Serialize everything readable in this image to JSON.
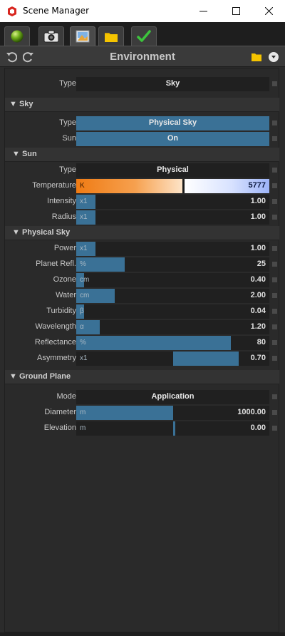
{
  "window": {
    "title": "Scene Manager",
    "minimize": "—",
    "maximize": "☐",
    "close": "✕"
  },
  "tabs": [
    {
      "name": "environment",
      "icon": "green-sphere-icon"
    },
    {
      "name": "camera",
      "icon": "camera-icon"
    },
    {
      "name": "image",
      "icon": "picture-icon"
    },
    {
      "name": "folder",
      "icon": "folder-icon"
    },
    {
      "name": "check",
      "icon": "checkmark-icon"
    }
  ],
  "toolbar": {
    "title": "Environment"
  },
  "environment": {
    "type_label": "Type",
    "type_value": "Sky"
  },
  "sky": {
    "section": "Sky",
    "type_label": "Type",
    "type_value": "Physical Sky",
    "sun_label": "Sun",
    "sun_value": "On"
  },
  "sun": {
    "section": "Sun",
    "type_label": "Type",
    "type_value": "Physical",
    "temperature": {
      "label": "Temperature",
      "unit": "K",
      "value": "5777",
      "fraction": 0.55
    },
    "intensity": {
      "label": "Intensity",
      "unit": "x1",
      "value": "1.00",
      "fraction": 0.1
    },
    "radius": {
      "label": "Radius",
      "unit": "x1",
      "value": "1.00",
      "fraction": 0.1
    }
  },
  "physical_sky": {
    "section": "Physical Sky",
    "rows": [
      {
        "key": "power",
        "label": "Power",
        "unit": "x1",
        "value": "1.00",
        "fraction": 0.1
      },
      {
        "key": "planet-reflectance",
        "label": "Planet Refl.",
        "unit": "%",
        "value": "25",
        "fraction": 0.25
      },
      {
        "key": "ozone",
        "label": "Ozone",
        "unit": "cm",
        "value": "0.40",
        "fraction": 0.04
      },
      {
        "key": "water",
        "label": "Water",
        "unit": "cm",
        "value": "2.00",
        "fraction": 0.2
      },
      {
        "key": "turbidity",
        "label": "Turbidity",
        "unit": "β",
        "value": "0.04",
        "fraction": 0.04
      },
      {
        "key": "wavelength",
        "label": "Wavelength",
        "unit": "α",
        "value": "1.20",
        "fraction": 0.12
      },
      {
        "key": "reflectance",
        "label": "Reflectance",
        "unit": "%",
        "value": "80",
        "fraction": 0.8
      }
    ],
    "asymmetry": {
      "label": "Asymmetry",
      "unit": "x1",
      "value": "0.70",
      "fraction": 0.7
    }
  },
  "ground_plane": {
    "section": "Ground Plane",
    "mode_label": "Mode",
    "mode_value": "Application",
    "diameter": {
      "label": "Diameter",
      "unit": "m",
      "value": "1000.00",
      "fraction": 0.5
    },
    "elevation": {
      "label": "Elevation",
      "unit": "m",
      "value": "0.00",
      "fraction": 0.5
    }
  },
  "colors": {
    "slider_fill": "#3a7196",
    "accent_green": "#3cc43c",
    "folder_yellow": "#f5c400"
  }
}
